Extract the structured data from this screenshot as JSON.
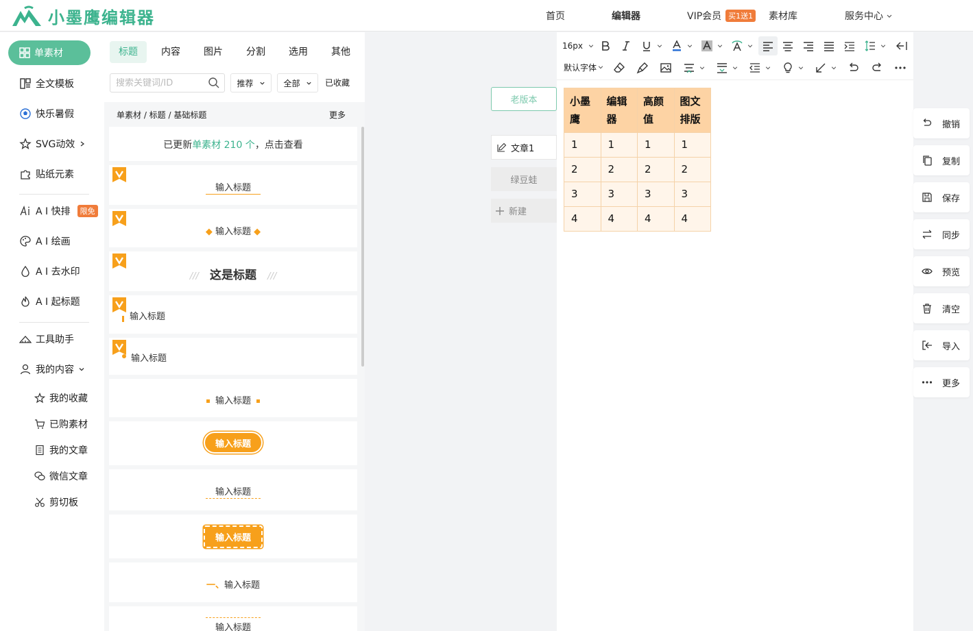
{
  "brand": {
    "name": "小墨鹰编辑器",
    "color": "#3cb38e"
  },
  "nav": {
    "home": "首页",
    "editor": "编辑器",
    "vip": "VIP会员",
    "vip_badge": "买1送1",
    "library": "素材库",
    "service": "服务中心"
  },
  "sidebar": {
    "active": "单素材",
    "items": [
      "全文模板",
      "快乐暑假",
      "SVG动效",
      "贴纸元素"
    ],
    "ai": [
      "A I 快排",
      "A I 绘画",
      "A I 去水印",
      "A I 起标题"
    ],
    "ai_badge": "限免",
    "tools": "工具助手",
    "mine": "我的内容",
    "mine_sub": [
      "我的收藏",
      "已购素材",
      "我的文章",
      "微信文章",
      "剪切板"
    ]
  },
  "panel": {
    "tabs": [
      "标题",
      "内容",
      "图片",
      "分割",
      "选用",
      "其他"
    ],
    "search_placeholder": "搜索关键词/ID",
    "filter_recommend": "推荐",
    "filter_all": "全部",
    "favorites": "已收藏",
    "breadcrumb": "单素材 / 标题 / 基础标题",
    "more": "更多",
    "update_prefix": "已更新",
    "update_link": "单素材 210 个",
    "update_suffix": "，点击查看",
    "titles": [
      "输入标题",
      "输入标题",
      "这是标题",
      "输入标题",
      "输入标题",
      "输入标题",
      "输入标题",
      "输入标题",
      "输入标题",
      "一、",
      "输入标题",
      "输入标题"
    ]
  },
  "middle": {
    "old_version": "老版本",
    "doc": "文章1",
    "frog": "绿豆蛙",
    "new": "新建"
  },
  "toolbar": {
    "font_size": "16px",
    "font_family": "默认字体"
  },
  "table": {
    "headers": [
      "小墨鹰",
      "编辑器",
      "高颜值",
      "图文排版"
    ],
    "rows": [
      [
        "1",
        "1",
        "1",
        "1"
      ],
      [
        "2",
        "2",
        "2",
        "2"
      ],
      [
        "3",
        "3",
        "3",
        "3"
      ],
      [
        "4",
        "4",
        "4",
        "4"
      ]
    ]
  },
  "actions": [
    "撤销",
    "复制",
    "保存",
    "同步",
    "预览",
    "清空",
    "导入",
    "更多"
  ],
  "colors": {
    "accent": "#5bbf9a",
    "orange": "#f7a01b",
    "table_header": "#fdd3a4",
    "table_bg": "#fff5ea"
  }
}
